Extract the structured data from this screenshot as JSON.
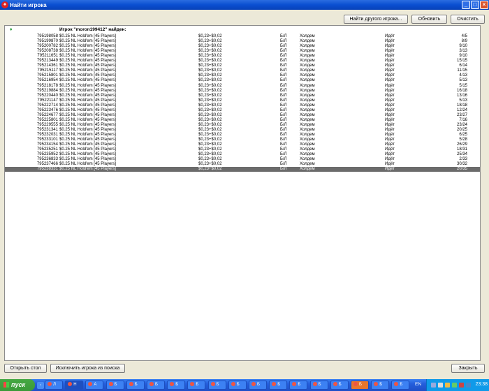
{
  "window": {
    "title": "Найти игрока"
  },
  "toolbar": {
    "find_other": "Найти другого игрока...",
    "refresh": "Обновить",
    "clear": "Очистить"
  },
  "results": {
    "header": "Игрок \"moron199412\" найден:",
    "rows": [
      {
        "id": "795198058",
        "game": "$0.25 NL Hold'em [45 Players]",
        "stakes": "$0,23+$0,02",
        "type": "Б/Л",
        "speed": "Холдем",
        "status": "Идёт",
        "players": "4/5"
      },
      {
        "id": "795199870",
        "game": "$0.25 NL Hold'em [45 Players]",
        "stakes": "$0,23+$0,02",
        "type": "Б/Л",
        "speed": "Холдем",
        "status": "Идёт",
        "players": "8/9"
      },
      {
        "id": "795200782",
        "game": "$0.25 NL Hold'em [45 Players]",
        "stakes": "$0,23+$0,02",
        "type": "Б/Л",
        "speed": "Холдем",
        "status": "Идёт",
        "players": "9/10"
      },
      {
        "id": "795208738",
        "game": "$0.25 NL Hold'em [45 Players]",
        "stakes": "$0,23+$0,02",
        "type": "Б/Л",
        "speed": "Холдем",
        "status": "Идёт",
        "players": "3/13"
      },
      {
        "id": "795211651",
        "game": "$0.25 NL Hold'em [45 Players]",
        "stakes": "$0,23+$0,02",
        "type": "Б/Л",
        "speed": "Холдем",
        "status": "Идёт",
        "players": "9/10"
      },
      {
        "id": "795213449",
        "game": "$0.25 NL Hold'em [45 Players]",
        "stakes": "$0,23+$0,02",
        "type": "Б/Л",
        "speed": "Холдем",
        "status": "Идёт",
        "players": "15/15"
      },
      {
        "id": "795214361",
        "game": "$0.25 NL Hold'em [45 Players]",
        "stakes": "$0,23+$0,02",
        "type": "Б/Л",
        "speed": "Холдем",
        "status": "Идёт",
        "players": "6/14"
      },
      {
        "id": "795215117",
        "game": "$0.25 NL Hold'em [45 Players]",
        "stakes": "$0,23+$0,02",
        "type": "Б/Л",
        "speed": "Холдем",
        "status": "Идёт",
        "players": "11/15"
      },
      {
        "id": "795215801",
        "game": "$0.25 NL Hold'em [45 Players]",
        "stakes": "$0,23+$0,02",
        "type": "Б/Л",
        "speed": "Холдем",
        "status": "Идёт",
        "players": "4/13"
      },
      {
        "id": "795216954",
        "game": "$0.25 NL Hold'em [45 Players]",
        "stakes": "$0,23+$0,02",
        "type": "Б/Л",
        "speed": "Холдем",
        "status": "Идёт",
        "players": "5/13"
      },
      {
        "id": "795218178",
        "game": "$0.25 NL Hold'em [45 Players]",
        "stakes": "$0,23+$0,02",
        "type": "Б/Л",
        "speed": "Холдем",
        "status": "Идёт",
        "players": "5/15"
      },
      {
        "id": "795219884",
        "game": "$0.25 NL Hold'em [45 Players]",
        "stakes": "$0,23+$0,02",
        "type": "Б/Л",
        "speed": "Холдем",
        "status": "Идёт",
        "players": "16/18"
      },
      {
        "id": "795220440",
        "game": "$0.25 NL Hold'em [45 Players]",
        "stakes": "$0,23+$0,02",
        "type": "Б/Л",
        "speed": "Холдем",
        "status": "Идёт",
        "players": "13/16"
      },
      {
        "id": "795221147",
        "game": "$0.25 NL Hold'em [45 Players]",
        "stakes": "$0,23+$0,02",
        "type": "Б/Л",
        "speed": "Холдем",
        "status": "Идёт",
        "players": "5/13"
      },
      {
        "id": "795222714",
        "game": "$0.25 NL Hold'em [45 Players]",
        "stakes": "$0,23+$0,02",
        "type": "Б/Л",
        "speed": "Холдем",
        "status": "Идёт",
        "players": "18/18"
      },
      {
        "id": "795223476",
        "game": "$0.25 NL Hold'em [45 Players]",
        "stakes": "$0,23+$0,02",
        "type": "Б/Л",
        "speed": "Холдем",
        "status": "Идёт",
        "players": "12/24"
      },
      {
        "id": "795224677",
        "game": "$0.25 NL Hold'em [45 Players]",
        "stakes": "$0,23+$0,02",
        "type": "Б/Л",
        "speed": "Холдем",
        "status": "Идёт",
        "players": "23/27"
      },
      {
        "id": "795225801",
        "game": "$0.25 NL Hold'em [45 Players]",
        "stakes": "$0,23+$0,02",
        "type": "Б/Л",
        "speed": "Холдем",
        "status": "Идёт",
        "players": "7/16"
      },
      {
        "id": "795229555",
        "game": "$0.25 NL Hold'em [45 Players]",
        "stakes": "$0,23+$0,02",
        "type": "Б/Л",
        "speed": "Холдем",
        "status": "Идёт",
        "players": "23/24"
      },
      {
        "id": "795231341",
        "game": "$0.25 NL Hold'em [45 Players]",
        "stakes": "$0,23+$0,02",
        "type": "Б/Л",
        "speed": "Холдем",
        "status": "Идёт",
        "players": "20/25"
      },
      {
        "id": "795232031",
        "game": "$0.25 NL Hold'em [45 Players]",
        "stakes": "$0,23+$0,02",
        "type": "Б/Л",
        "speed": "Холдем",
        "status": "Идёт",
        "players": "6/25"
      },
      {
        "id": "795233101",
        "game": "$0.25 NL Hold'em [45 Players]",
        "stakes": "$0,23+$0,02",
        "type": "Б/Л",
        "speed": "Холдем",
        "status": "Идёт",
        "players": "5/28"
      },
      {
        "id": "795234154",
        "game": "$0.25 NL Hold'em [45 Players]",
        "stakes": "$0,23+$0,02",
        "type": "Б/Л",
        "speed": "Холдем",
        "status": "Идёт",
        "players": "26/29"
      },
      {
        "id": "795235251",
        "game": "$0.25 NL Hold'em [45 Players]",
        "stakes": "$0,23+$0,02",
        "type": "Б/Л",
        "speed": "Холдем",
        "status": "Идёт",
        "players": "18/31"
      },
      {
        "id": "795235952",
        "game": "$0.25 NL Hold'em [45 Players]",
        "stakes": "$0,23+$0,02",
        "type": "Б/Л",
        "speed": "Холдем",
        "status": "Идёт",
        "players": "25/34"
      },
      {
        "id": "795236833",
        "game": "$0.25 NL Hold'em [45 Players]",
        "stakes": "$0,23+$0,02",
        "type": "Б/Л",
        "speed": "Холдем",
        "status": "Идёт",
        "players": "2/33"
      },
      {
        "id": "795237466",
        "game": "$0.25 NL Hold'em [45 Players]",
        "stakes": "$0,23+$0,02",
        "type": "Б/Л",
        "speed": "Холдем",
        "status": "Идёт",
        "players": "30/32"
      },
      {
        "id": "795238331",
        "game": "$0.25 NL Hold'em [45 Players]",
        "stakes": "$0,23+$0,02",
        "type": "Б/Л",
        "speed": "Холдем",
        "status": "Идёт",
        "players": "20/35",
        "selected": true
      }
    ]
  },
  "footer": {
    "open_table": "Открыть стол",
    "exclude": "Исключить игрока из поиска",
    "close": "Закрыть"
  },
  "taskbar": {
    "start_label": "пуск",
    "buttons": [
      "Л",
      "Н",
      "А",
      "Б",
      "Б",
      "Б",
      "Б",
      "Б",
      "Б",
      "Б",
      "Б",
      "Б",
      "Б",
      "Б",
      "Б",
      "Б",
      "Б",
      "Б"
    ],
    "lang": "EN",
    "clock": "23:38"
  }
}
